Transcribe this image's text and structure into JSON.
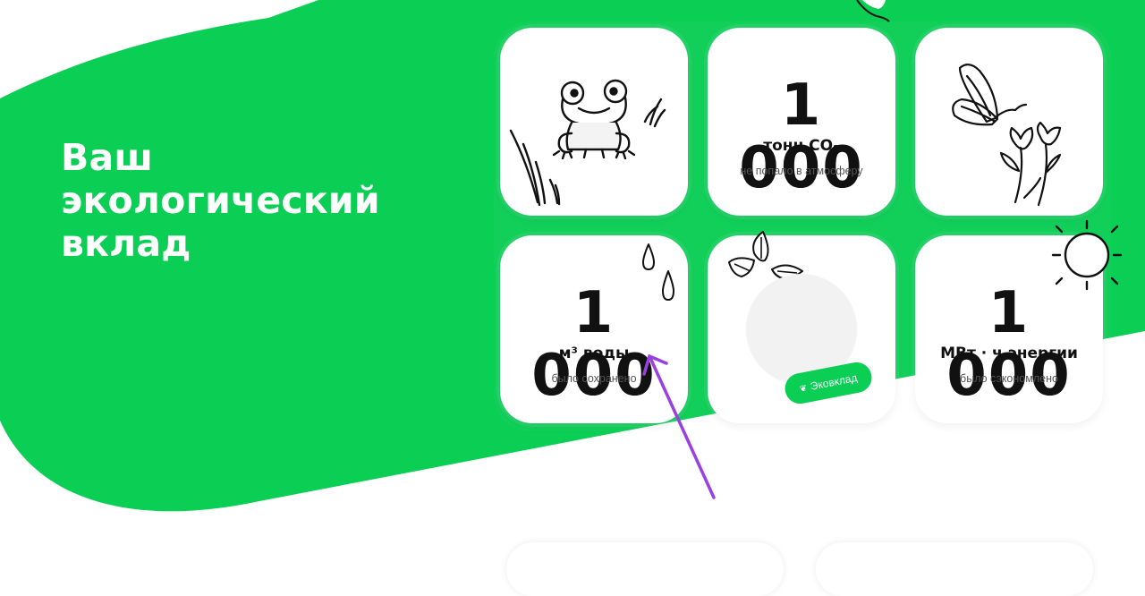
{
  "colors": {
    "brand_green": "#0bce55",
    "annotation_purple": "#9b40e0"
  },
  "hero": {
    "title_lines": [
      "Ваш",
      "экологический",
      "вклад"
    ]
  },
  "cards": [
    {
      "type": "illustration",
      "icon": "frog-icon"
    },
    {
      "type": "stat",
      "value": "1 000",
      "unit_main": "тонн CO",
      "unit_sub": "2",
      "caption": "не попало в атмосферу"
    },
    {
      "type": "illustration",
      "icon": "butterfly-flowers-icon"
    },
    {
      "type": "stat",
      "value": "1 000",
      "unit_main": "м³ воды",
      "caption": "было сохранено",
      "icon": "water-drops-icon"
    },
    {
      "type": "badge",
      "label": "Эковклад",
      "icon": "leaves-icon"
    },
    {
      "type": "stat",
      "value": "1 000",
      "unit_main": "МВт · ч энергии",
      "caption": "было сэкономлено",
      "icon": "sun-icon"
    }
  ]
}
